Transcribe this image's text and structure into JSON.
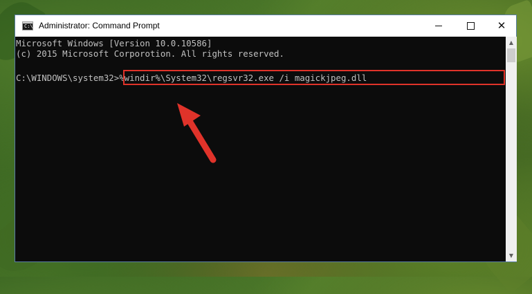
{
  "window": {
    "title": "Administrator: Command Prompt",
    "icon_label": "C:\\"
  },
  "controls": {
    "minimize": "minimize-icon",
    "maximize": "maximize-icon",
    "close": "close-icon"
  },
  "console": {
    "line1": "Microsoft Windows [Version 10.0.10586]",
    "line2": "(c) 2015 Microsoft Corporotion. All rights reserved.",
    "prompt": "C:\\WINDOWS\\system32>",
    "command": "%windir%\\System32\\regsvr32.exe /i magickjpeg.dll"
  },
  "colors": {
    "console_bg": "#0c0c0c",
    "console_text": "#c0c0c0",
    "highlight": "#e0332a",
    "arrow": "#e0332a"
  }
}
